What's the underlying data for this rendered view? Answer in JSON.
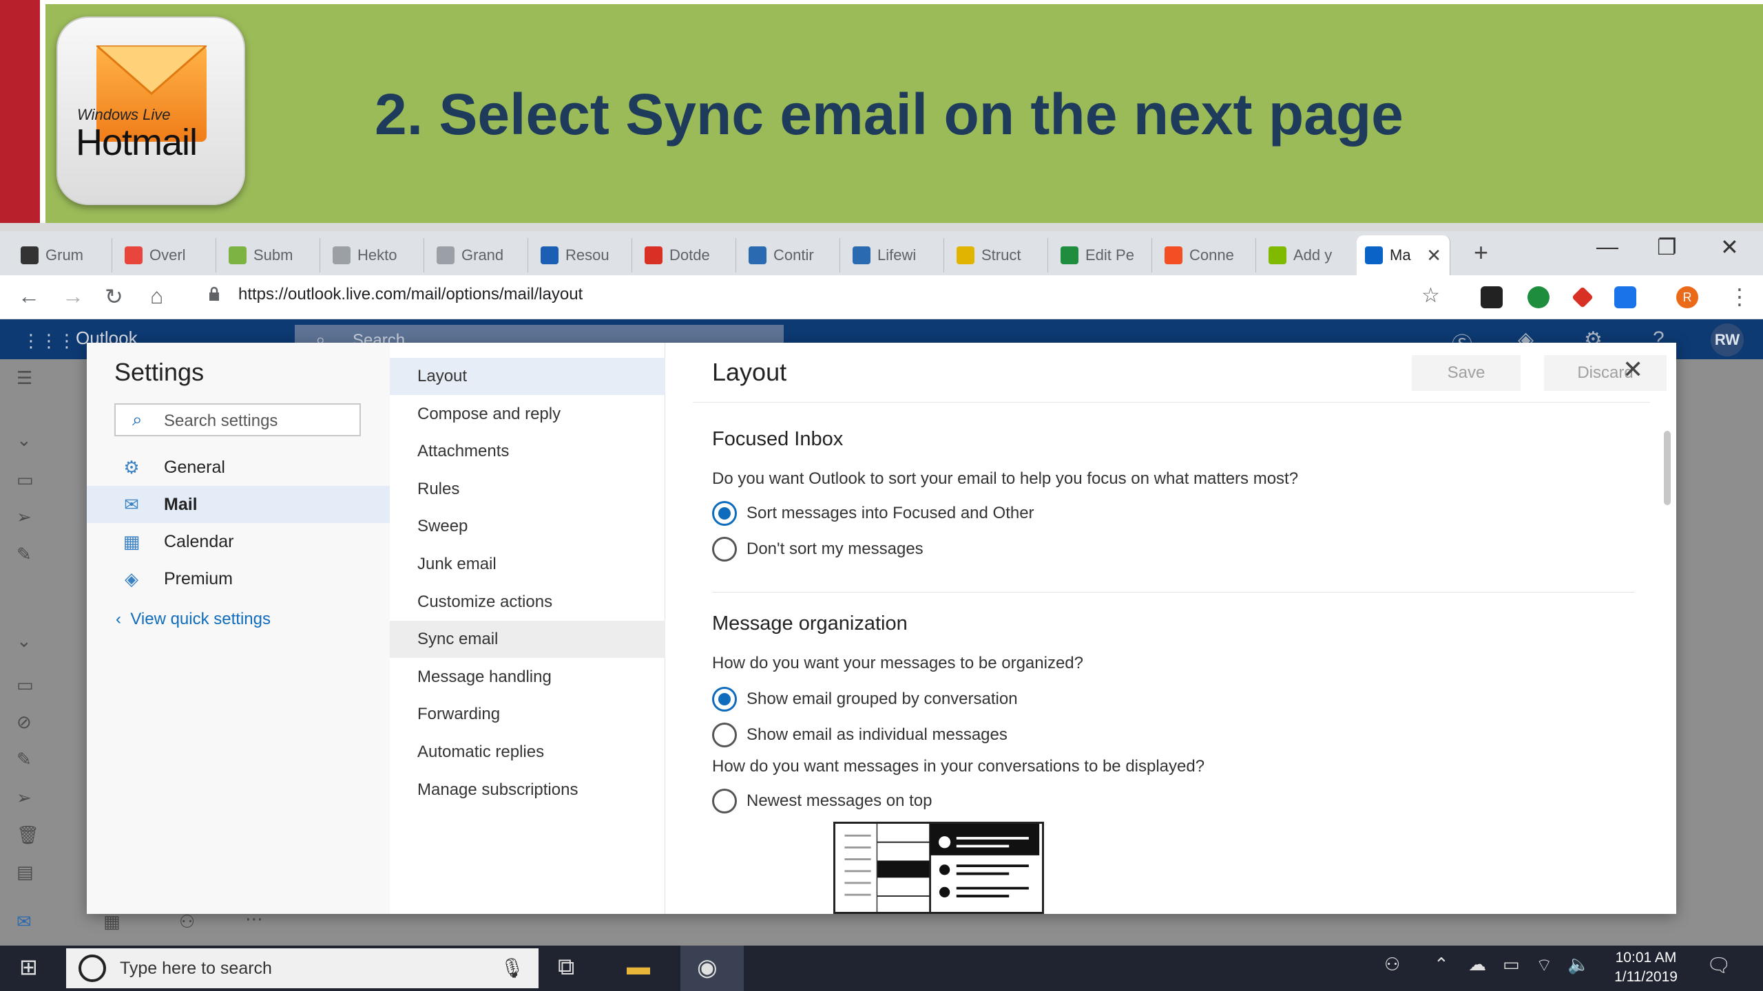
{
  "slide": {
    "title": "2. Select Sync email on the next page",
    "logo_line1": "Windows Live",
    "logo_line2": "Hotmail"
  },
  "browser": {
    "tabs": [
      {
        "label": "Grum",
        "color": "#333333"
      },
      {
        "label": "Overl",
        "color": "#e8453c"
      },
      {
        "label": "Subm",
        "color": "#7cb342"
      },
      {
        "label": "Hekto",
        "color": "#9aa0a6"
      },
      {
        "label": "Grand",
        "color": "#9aa0a6"
      },
      {
        "label": "Resou",
        "color": "#1a5fb4"
      },
      {
        "label": "Dotde",
        "color": "#d93025"
      },
      {
        "label": "Contir",
        "color": "#2a6ab0"
      },
      {
        "label": "Lifewi",
        "color": "#2a6ab0"
      },
      {
        "label": "Struct",
        "color": "#e0b400"
      },
      {
        "label": "Edit Pe",
        "color": "#1e8e3e"
      },
      {
        "label": "Conne",
        "color": "#f25022"
      },
      {
        "label": "Add y",
        "color": "#7fba00"
      }
    ],
    "active_tab": {
      "label": "Ma",
      "close": "✕"
    },
    "new_tab": "+",
    "window_controls": {
      "minimize": "—",
      "restore": "❐",
      "close": "✕"
    },
    "url": "https://outlook.live.com/mail/options/mail/layout",
    "profile_initial": "R"
  },
  "outlook": {
    "brand": "Outlook",
    "search_placeholder": "Search",
    "avatar": "RW"
  },
  "settings": {
    "title": "Settings",
    "search_placeholder": "Search settings",
    "categories": [
      {
        "label": "General",
        "icon": "gear-icon"
      },
      {
        "label": "Mail",
        "icon": "mail-icon"
      },
      {
        "label": "Calendar",
        "icon": "calendar-icon"
      },
      {
        "label": "Premium",
        "icon": "diamond-icon"
      }
    ],
    "view_quick": "View quick settings",
    "mail_items": [
      "Layout",
      "Compose and reply",
      "Attachments",
      "Rules",
      "Sweep",
      "Junk email",
      "Customize actions",
      "Sync email",
      "Message handling",
      "Forwarding",
      "Automatic replies",
      "Manage subscriptions"
    ]
  },
  "layout_pane": {
    "title": "Layout",
    "save": "Save",
    "discard": "Discard",
    "focused_title": "Focused Inbox",
    "focused_q": "Do you want Outlook to sort your email to help you focus on what matters most?",
    "focused_opt1": "Sort messages into Focused and Other",
    "focused_opt2": "Don't sort my messages",
    "org_title": "Message organization",
    "org_q": "How do you want your messages to be organized?",
    "org_opt1": "Show email grouped by conversation",
    "org_opt2": "Show email as individual messages",
    "conv_q": "How do you want messages in your conversations to be displayed?",
    "conv_opt1": "Newest messages on top"
  },
  "taskbar": {
    "search_placeholder": "Type here to search",
    "time": "10:01 AM",
    "date": "1/11/2019"
  },
  "colors": {
    "banner_green": "#9bbb59",
    "banner_red": "#b8202c",
    "title_navy": "#1f3b5c",
    "outlook_blue": "#0d3a73",
    "accent": "#0f6cbd"
  }
}
